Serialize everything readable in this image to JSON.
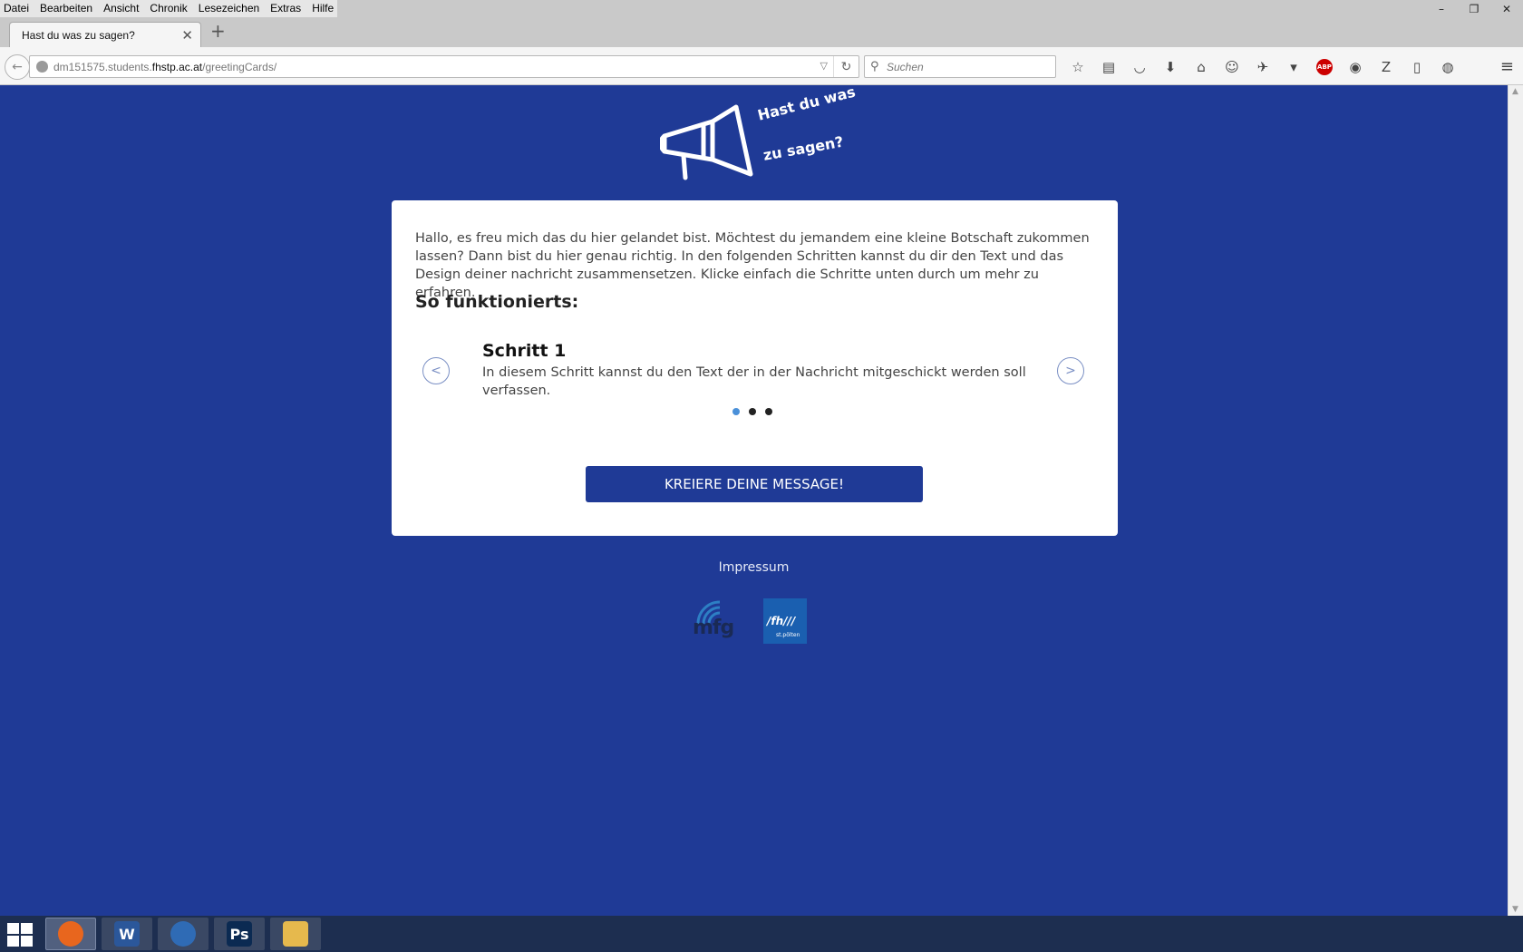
{
  "browser": {
    "menu": [
      "Datei",
      "Bearbeiten",
      "Ansicht",
      "Chronik",
      "Lesezeichen",
      "Extras",
      "Hilfe"
    ],
    "tab": {
      "title": "Hast du was zu sagen?",
      "close": "✕"
    },
    "new_tab": "+",
    "url": {
      "prefix": "dm151575.students.",
      "host": "fhstp.ac.at",
      "path": "/greetingCards/"
    },
    "search": {
      "placeholder": "Suchen"
    },
    "abp_label": "ABP",
    "window_controls": {
      "minimize": "–",
      "restore": "❐",
      "close": "✕"
    }
  },
  "page": {
    "logo": {
      "line1": "Hast du was",
      "line2": "zu sagen?"
    },
    "intro": "Hallo, es freu mich das du hier gelandet bist. Möchtest du jemandem eine kleine Botschaft zukommen lassen? Dann bist du hier genau richtig. In den folgenden Schritten kannst du dir den Text und das Design deiner nachricht zusammensetzen. Klicke einfach die Schritte unten durch um mehr zu erfahren.",
    "how_heading": "So funktionierts:",
    "slide": {
      "title": "Schritt 1",
      "text": "In diesem Schritt kannst du den Text der in der Nachricht mitgeschickt werden soll verfassen."
    },
    "carousel": {
      "total": 3,
      "active_index": 0
    },
    "cta_label": "KREIERE DEINE MESSAGE!",
    "impressum": "Impressum",
    "partner_logos": {
      "mfg": "mfg",
      "fh": "/fh///",
      "fh_sub": "st.pölten"
    }
  },
  "taskbar": {
    "apps": [
      {
        "name": "firefox",
        "glyph": "",
        "color": "#e8661e",
        "active": true
      },
      {
        "name": "word",
        "glyph": "W",
        "color": "#2b579a",
        "active": false
      },
      {
        "name": "thunderbird",
        "glyph": "",
        "color": "#2f6bb5",
        "active": false
      },
      {
        "name": "photoshop",
        "glyph": "Ps",
        "color": "#0b2a52",
        "active": false
      },
      {
        "name": "explorer",
        "glyph": "",
        "color": "#e6b94d",
        "active": false
      }
    ]
  },
  "colors": {
    "page_bg": "#1f3a96",
    "accent": "#1f3a96",
    "dot_active": "#4a90d9"
  }
}
